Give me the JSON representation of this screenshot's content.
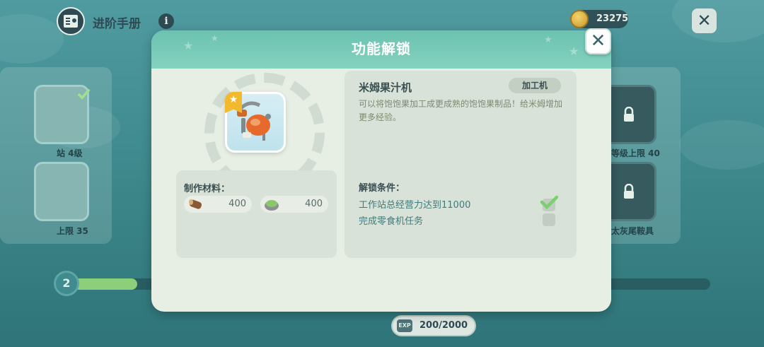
{
  "header": {
    "title": "进阶手册",
    "coins": "23275"
  },
  "background": {
    "labels": [
      "站 4级",
      "上限 35",
      "等级上限 40",
      "太灰尾鞍具"
    ],
    "level": "2"
  },
  "exp": {
    "badge": "EXP",
    "value": "200/2000",
    "fill_fraction": 0.1
  },
  "modal": {
    "title": "功能解锁",
    "materials_label": "制作材料：",
    "materials": [
      {
        "icon": "wood-log-icon",
        "amount": "400"
      },
      {
        "icon": "stone-ore-icon",
        "amount": "400"
      }
    ],
    "item_name": "米姆果汁机",
    "item_type": "加工机",
    "description": "可以将饱饱果加工成更成熟的饱饱果制品！给米姆增加更多经验。",
    "conditions_label": "解锁条件：",
    "conditions": [
      {
        "text": "工作站总经营力达到11000",
        "done": true
      },
      {
        "text": "完成零食机任务",
        "done": false
      }
    ]
  },
  "colors": {
    "header_teal": "#6cc2b0",
    "modal_bg": "#e7eee4",
    "condition_text": "#3f7b7b",
    "check_green": "#7ccf6f"
  }
}
